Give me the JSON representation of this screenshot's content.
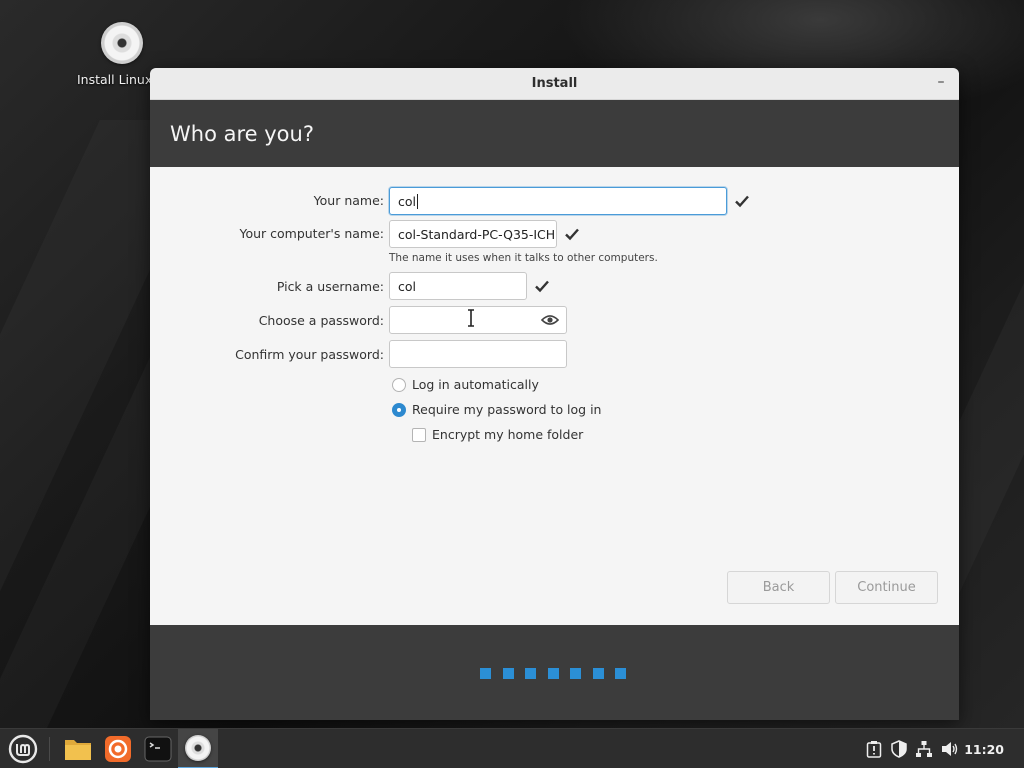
{
  "desktop": {
    "icons": [
      {
        "label": "Install Linux M",
        "icon": "disc-icon"
      }
    ]
  },
  "window": {
    "title": "Install",
    "minimize_label": "–",
    "header_title": "Who are you?"
  },
  "form": {
    "your_name": {
      "label": "Your name:",
      "value": "col",
      "valid": true
    },
    "computer_name": {
      "label": "Your computer's name:",
      "value": "col-Standard-PC-Q35-ICH",
      "hint": "The name it uses when it talks to other computers.",
      "valid": true
    },
    "username": {
      "label": "Pick a username:",
      "value": "col",
      "valid": true
    },
    "password": {
      "label": "Choose a password:",
      "value": "",
      "icon": "eye-icon"
    },
    "confirm_password": {
      "label": "Confirm your password:",
      "value": ""
    },
    "login_options": [
      {
        "label": "Log in automatically",
        "selected": false
      },
      {
        "label": "Require my password to log in",
        "selected": true
      }
    ],
    "encrypt_home": {
      "label": "Encrypt my home folder",
      "checked": false
    }
  },
  "buttons": {
    "back": "Back",
    "continue": "Continue"
  },
  "progress": {
    "total_steps": 7,
    "accent": "#2b8fd6"
  },
  "taskbar": {
    "apps": [
      "mint-menu-icon",
      "files-icon",
      "firefox-icon",
      "terminal-icon",
      "installer-icon"
    ],
    "tray": [
      "update-icon",
      "shield-icon",
      "network-icon",
      "volume-icon"
    ],
    "clock": "11:20"
  },
  "colors": {
    "accent": "#2d89cf",
    "header_bg": "#3c3c3c",
    "content_bg": "#f5f5f5"
  }
}
